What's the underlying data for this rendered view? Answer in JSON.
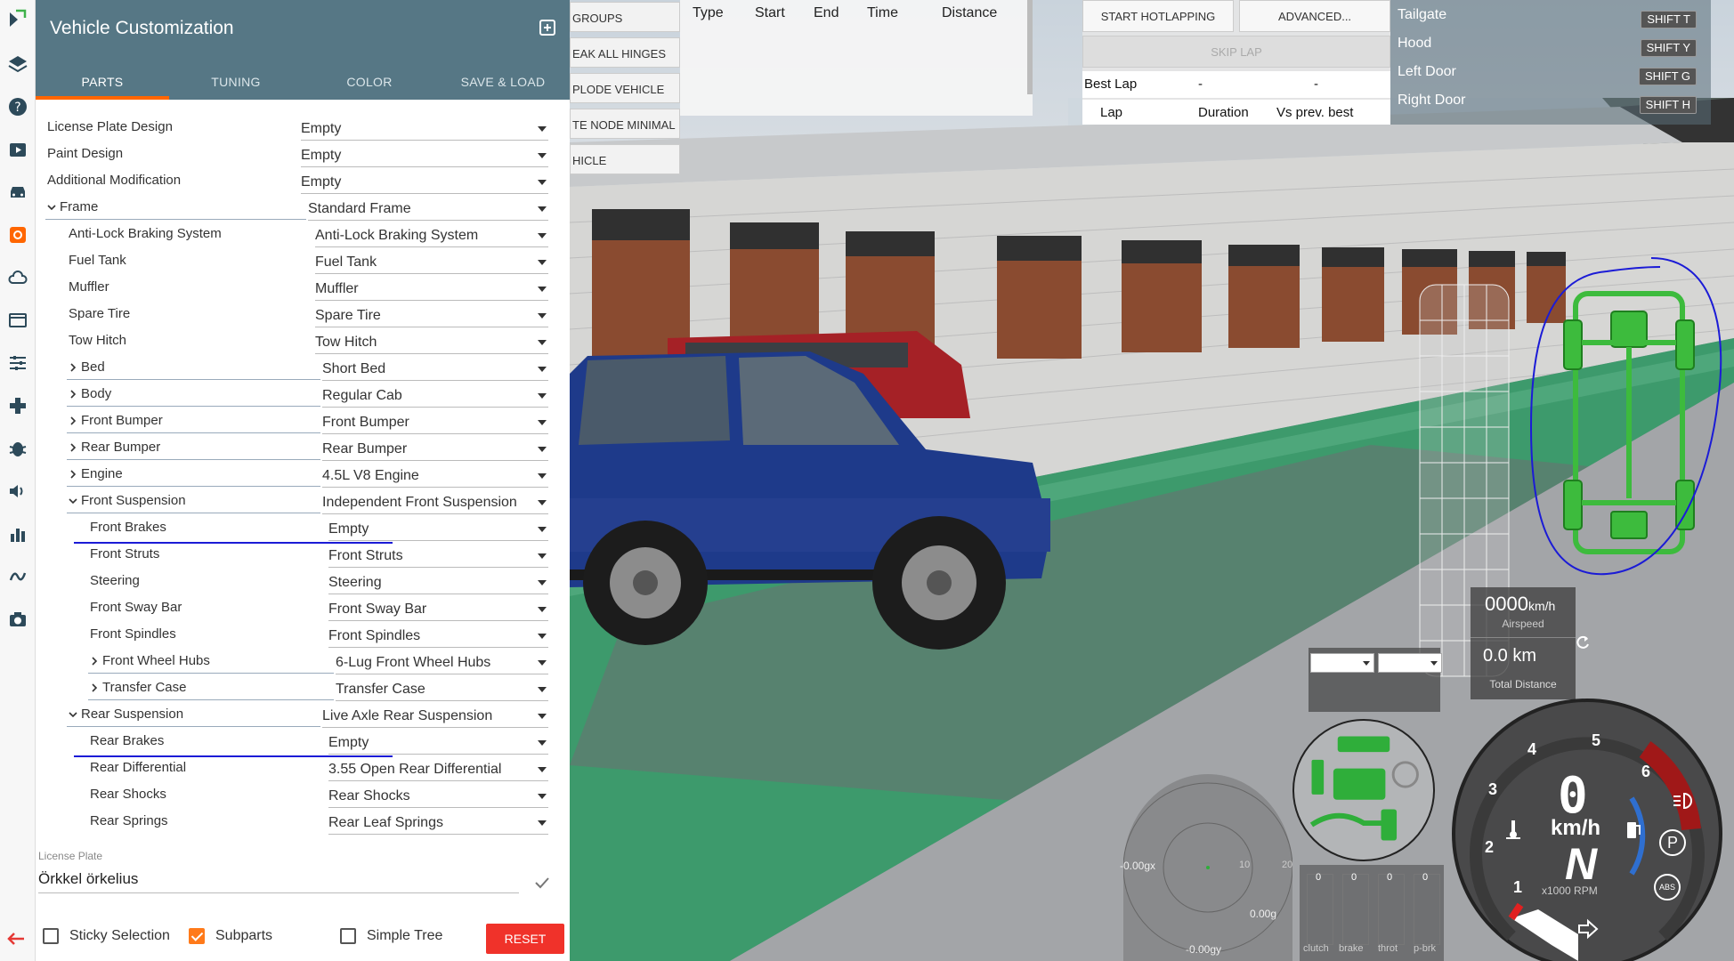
{
  "panel": {
    "title": "Vehicle Customization",
    "tabs": [
      "PARTS",
      "TUNING",
      "COLOR",
      "SAVE & LOAD"
    ],
    "rows": [
      {
        "label": "License Plate Design",
        "value": "Empty",
        "indent": 0,
        "chev": "",
        "valx": 338
      },
      {
        "label": "Paint Design",
        "value": "Empty",
        "indent": 0,
        "chev": "",
        "valx": 338
      },
      {
        "label": "Additional Modification",
        "value": "Empty",
        "indent": 0,
        "chev": "",
        "valx": 338
      },
      {
        "label": "Frame",
        "value": "Standard Frame",
        "indent": 0,
        "chev": "down",
        "valx": 346
      },
      {
        "label": "Anti-Lock Braking System",
        "value": "Anti-Lock Braking System",
        "indent": 1,
        "chev": "",
        "valx": 354
      },
      {
        "label": "Fuel Tank",
        "value": "Fuel Tank",
        "indent": 1,
        "chev": "",
        "valx": 354
      },
      {
        "label": "Muffler",
        "value": "Muffler",
        "indent": 1,
        "chev": "",
        "valx": 354
      },
      {
        "label": "Spare Tire",
        "value": "Spare Tire",
        "indent": 1,
        "chev": "",
        "valx": 354
      },
      {
        "label": "Tow Hitch",
        "value": "Tow Hitch",
        "indent": 1,
        "chev": "",
        "valx": 354
      },
      {
        "label": "Bed",
        "value": "Short Bed",
        "indent": 1,
        "chev": "right",
        "valx": 362
      },
      {
        "label": "Body",
        "value": "Regular Cab",
        "indent": 1,
        "chev": "right",
        "valx": 362
      },
      {
        "label": "Front Bumper",
        "value": "Front Bumper",
        "indent": 1,
        "chev": "right",
        "valx": 362
      },
      {
        "label": "Rear Bumper",
        "value": "Rear Bumper",
        "indent": 1,
        "chev": "right",
        "valx": 362
      },
      {
        "label": "Engine",
        "value": "4.5L V8 Engine",
        "indent": 1,
        "chev": "right",
        "valx": 362
      },
      {
        "label": "Front Suspension",
        "value": "Independent Front Suspension",
        "indent": 1,
        "chev": "down",
        "valx": 362
      },
      {
        "label": "Front Brakes",
        "value": "Empty",
        "indent": 2,
        "chev": "",
        "valx": 369,
        "annot": true
      },
      {
        "label": "Front Struts",
        "value": "Front Struts",
        "indent": 2,
        "chev": "",
        "valx": 369
      },
      {
        "label": "Steering",
        "value": "Steering",
        "indent": 2,
        "chev": "",
        "valx": 369
      },
      {
        "label": "Front Sway Bar",
        "value": "Front Sway Bar",
        "indent": 2,
        "chev": "",
        "valx": 369
      },
      {
        "label": "Front Spindles",
        "value": "Front Spindles",
        "indent": 2,
        "chev": "",
        "valx": 369
      },
      {
        "label": "Front Wheel Hubs",
        "value": "6-Lug Front Wheel Hubs",
        "indent": 2,
        "chev": "right",
        "valx": 377
      },
      {
        "label": "Transfer Case",
        "value": "Transfer Case",
        "indent": 2,
        "chev": "right",
        "valx": 377
      },
      {
        "label": "Rear Suspension",
        "value": "Live Axle Rear Suspension",
        "indent": 1,
        "chev": "down",
        "valx": 362
      },
      {
        "label": "Rear Brakes",
        "value": "Empty",
        "indent": 2,
        "chev": "",
        "valx": 369,
        "annot": true
      },
      {
        "label": "Rear Differential",
        "value": "3.55 Open Rear Differential",
        "indent": 2,
        "chev": "",
        "valx": 369
      },
      {
        "label": "Rear Shocks",
        "value": "Rear Shocks",
        "indent": 2,
        "chev": "",
        "valx": 369
      },
      {
        "label": "Rear Springs",
        "value": "Rear Leaf Springs",
        "indent": 2,
        "chev": "",
        "valx": 369
      }
    ],
    "license_plate_label": "License Plate",
    "license_plate_value": "Örkkel örkelius",
    "sticky_selection": "Sticky Selection",
    "subparts": "Subparts",
    "simple_tree": "Simple Tree",
    "reset": "RESET"
  },
  "menu": [
    "GROUPS",
    "EAK ALL HINGES",
    "PLODE VEHICLE",
    "TE NODE MINIMAL",
    "HICLE"
  ],
  "table_headers": [
    "Type",
    "Start",
    "End",
    "Time",
    "Distance"
  ],
  "hotlap": {
    "start": "START HOTLAPPING",
    "advanced": "ADVANCED...",
    "skip": "SKIP LAP",
    "best_lap": "Best Lap",
    "best_dash1": "-",
    "best_dash2": "-",
    "col_lap": "Lap",
    "col_duration": "Duration",
    "col_vs": "Vs prev. best"
  },
  "keys": [
    {
      "label": "Tailgate",
      "key": "SHIFT T"
    },
    {
      "label": "Hood",
      "key": "SHIFT Y"
    },
    {
      "label": "Left Door",
      "key": "SHIFT G"
    },
    {
      "label": "Right Door",
      "key": "SHIFT H"
    }
  ],
  "hud": {
    "airspeed_value": "0000",
    "airspeed_unit": "km/h",
    "airspeed_label": "Airspeed",
    "distance_value": "0.0 km",
    "distance_label": "Total Distance",
    "gforce_x": "-0.00gx",
    "gforce_y": "-0.00gy",
    "gforce_z": "0.00g",
    "gforce_tick1": "10",
    "gforce_tick2": "20",
    "pedals": [
      {
        "label": "clutch",
        "value": "0"
      },
      {
        "label": "brake",
        "value": "0"
      },
      {
        "label": "throt",
        "value": "0"
      },
      {
        "label": "p-brk",
        "value": "0"
      }
    ],
    "speed": "0",
    "speed_unit": "km/h",
    "gear": "N",
    "rpm_label": "x1000 RPM",
    "gauge_ticks": [
      "1",
      "2",
      "3",
      "4",
      "5",
      "6"
    ],
    "abs_label": "ABS",
    "parking_label": "P"
  },
  "colors": {
    "header": "#567785",
    "accent": "#ff6600",
    "reset": "#f0322a",
    "annotation": "#1b1bd6",
    "status_green": "#2fae3a"
  }
}
